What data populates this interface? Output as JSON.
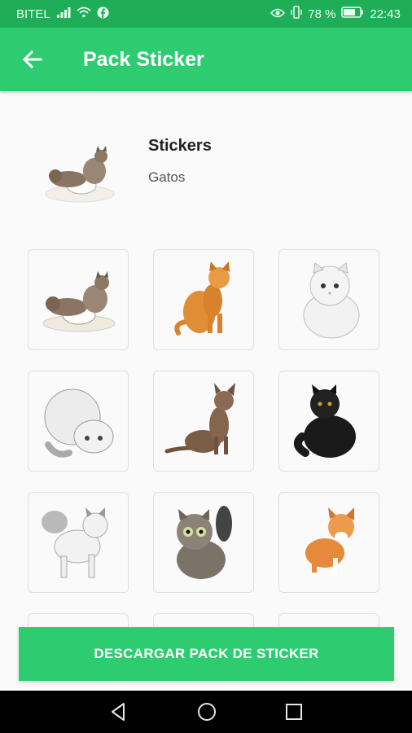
{
  "status_bar": {
    "carrier": "BITEL",
    "battery": "78 %",
    "time": "22:43",
    "icons": [
      "signal-icon",
      "wifi-icon",
      "facebook-icon",
      "eye-icon",
      "vibrate-icon",
      "battery-icon"
    ]
  },
  "app_bar": {
    "title": "Pack Sticker",
    "back_icon": "arrow-back-icon"
  },
  "pack": {
    "name": "Stickers",
    "author": "Gatos"
  },
  "stickers": [
    {
      "id": "cats-basket",
      "icon": "cat-sticker"
    },
    {
      "id": "orange-cat-sitting",
      "icon": "cat-sticker"
    },
    {
      "id": "white-persian-cat",
      "icon": "cat-sticker"
    },
    {
      "id": "white-fluffy-cat-lying",
      "icon": "cat-sticker"
    },
    {
      "id": "brown-cat-sitting",
      "icon": "cat-sticker"
    },
    {
      "id": "black-fluffy-cat",
      "icon": "cat-sticker"
    },
    {
      "id": "white-cat-standing",
      "icon": "cat-sticker"
    },
    {
      "id": "tabby-cat-waving",
      "icon": "cat-sticker"
    },
    {
      "id": "orange-kitten",
      "icon": "cat-sticker"
    }
  ],
  "actions": {
    "download_label": "DESCARGAR PACK DE STICKER"
  },
  "nav": {
    "icons": [
      "back-triangle-icon",
      "home-circle-icon",
      "recents-square-icon"
    ]
  },
  "colors": {
    "primary": "#2ecc71",
    "status_bar": "#1fae57",
    "background": "#fafafa"
  }
}
